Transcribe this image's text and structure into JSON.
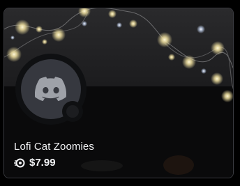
{
  "card": {
    "name": "Lofi Cat Zoomies",
    "price": "$7.99",
    "currency_icon": "orb-currency-icon",
    "avatar_icon": "discord-logo-icon"
  },
  "colors": {
    "background": "#000000",
    "card_border": "#3a3b40",
    "avatar_bg": "#36383f",
    "text": "#f2f3f5",
    "light_glow": "#f3e3a2"
  }
}
